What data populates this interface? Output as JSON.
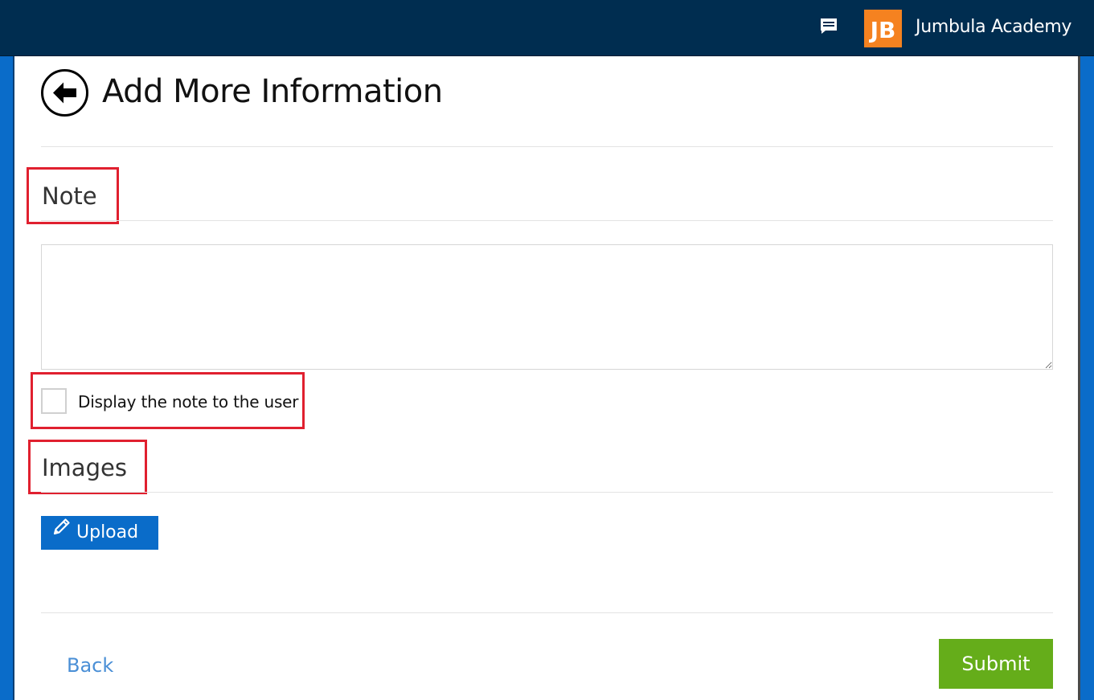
{
  "header": {
    "app_name": "Jumbula Academy",
    "logo_text": "JB",
    "chat_icon": "chat-message-icon",
    "background_color": "#002d50",
    "logo_color": "#f58220"
  },
  "page": {
    "title": "Add More Information",
    "back_icon": "arrow-left-circle-icon"
  },
  "note_section": {
    "heading": "Note",
    "textarea_value": "",
    "display_checkbox_label": "Display the note to the user",
    "display_checkbox_checked": false
  },
  "images_section": {
    "heading": "Images",
    "upload_label": "Upload",
    "upload_icon": "pencil-icon",
    "button_color": "#0a6cc9"
  },
  "footer": {
    "back_label": "Back",
    "submit_label": "Submit",
    "submit_color": "#65ad1a"
  },
  "annotation_color": "#e0202f"
}
